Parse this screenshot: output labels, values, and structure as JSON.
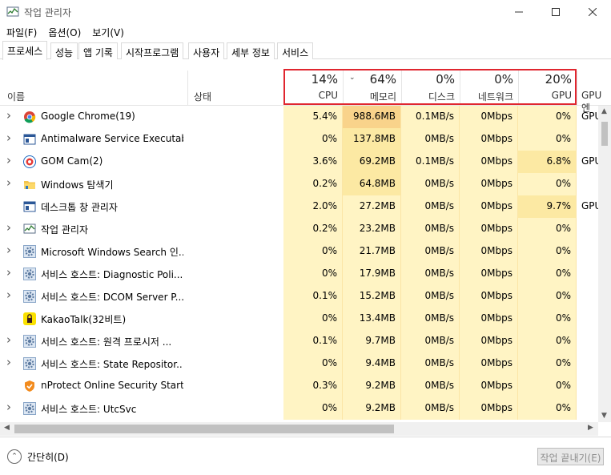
{
  "window": {
    "title": "작업 관리자"
  },
  "menu": [
    "파일(F)",
    "옵션(O)",
    "보기(V)"
  ],
  "tabs": [
    "프로세스",
    "성능",
    "앱 기록",
    "시작프로그램",
    "사용자",
    "세부 정보",
    "서비스"
  ],
  "header": {
    "name": "이름",
    "status": "상태",
    "cpu_pct": "14%",
    "cpu": "CPU",
    "mem_pct": "64%",
    "mem": "메모리",
    "disk_pct": "0%",
    "disk": "디스크",
    "net_pct": "0%",
    "net": "네트워크",
    "gpu_pct": "20%",
    "gpu": "GPU",
    "gpu_engine": "GPU 엔"
  },
  "rows": [
    {
      "name": "Google Chrome(19)",
      "cpu": "5.4%",
      "mem": "988.6MB",
      "disk": "0.1MB/s",
      "net": "0Mbps",
      "gpu": "0%",
      "gpueng": "GPU",
      "icon": "chrome-icon",
      "expand": true
    },
    {
      "name": "Antimalware Service Executable",
      "cpu": "0%",
      "mem": "137.8MB",
      "disk": "0MB/s",
      "net": "0Mbps",
      "gpu": "0%",
      "gpueng": "",
      "icon": "window-app-icon",
      "expand": true
    },
    {
      "name": "GOM Cam(2)",
      "cpu": "3.6%",
      "mem": "69.2MB",
      "disk": "0.1MB/s",
      "net": "0Mbps",
      "gpu": "6.8%",
      "gpueng": "GPU",
      "icon": "gomcam-icon",
      "expand": true
    },
    {
      "name": "Windows 탐색기",
      "cpu": "0.2%",
      "mem": "64.8MB",
      "disk": "0MB/s",
      "net": "0Mbps",
      "gpu": "0%",
      "gpueng": "",
      "icon": "folder-icon",
      "expand": true
    },
    {
      "name": "데스크톱 창 관리자",
      "cpu": "2.0%",
      "mem": "27.2MB",
      "disk": "0MB/s",
      "net": "0Mbps",
      "gpu": "9.7%",
      "gpueng": "GPU",
      "icon": "window-app-icon",
      "expand": false
    },
    {
      "name": "작업 관리자",
      "cpu": "0.2%",
      "mem": "23.2MB",
      "disk": "0MB/s",
      "net": "0Mbps",
      "gpu": "0%",
      "gpueng": "",
      "icon": "task-manager-icon",
      "expand": true
    },
    {
      "name": "Microsoft Windows Search 인...",
      "cpu": "0%",
      "mem": "21.7MB",
      "disk": "0MB/s",
      "net": "0Mbps",
      "gpu": "0%",
      "gpueng": "",
      "icon": "gear-icon",
      "expand": true
    },
    {
      "name": "서비스 호스트: Diagnostic Poli...",
      "cpu": "0%",
      "mem": "17.9MB",
      "disk": "0MB/s",
      "net": "0Mbps",
      "gpu": "0%",
      "gpueng": "",
      "icon": "gear-icon",
      "expand": true
    },
    {
      "name": "서비스 호스트: DCOM Server P...",
      "cpu": "0.1%",
      "mem": "15.2MB",
      "disk": "0MB/s",
      "net": "0Mbps",
      "gpu": "0%",
      "gpueng": "",
      "icon": "gear-icon",
      "expand": true
    },
    {
      "name": "KakaoTalk(32비트)",
      "cpu": "0%",
      "mem": "13.4MB",
      "disk": "0MB/s",
      "net": "0Mbps",
      "gpu": "0%",
      "gpueng": "",
      "icon": "kakaotalk-icon",
      "expand": false
    },
    {
      "name": "서비스 호스트: 원격 프로시저 ...",
      "cpu": "0.1%",
      "mem": "9.7MB",
      "disk": "0MB/s",
      "net": "0Mbps",
      "gpu": "0%",
      "gpueng": "",
      "icon": "gear-icon",
      "expand": true
    },
    {
      "name": "서비스 호스트: State Repositor...",
      "cpu": "0%",
      "mem": "9.4MB",
      "disk": "0MB/s",
      "net": "0Mbps",
      "gpu": "0%",
      "gpueng": "",
      "icon": "gear-icon",
      "expand": true
    },
    {
      "name": "nProtect Online Security Starte...",
      "cpu": "0.3%",
      "mem": "9.2MB",
      "disk": "0MB/s",
      "net": "0Mbps",
      "gpu": "0%",
      "gpueng": "",
      "icon": "shield-icon",
      "expand": false
    },
    {
      "name": "서비스 호스트: UtcSvc",
      "cpu": "0%",
      "mem": "9.2MB",
      "disk": "0MB/s",
      "net": "0Mbps",
      "gpu": "0%",
      "gpueng": "",
      "icon": "gear-icon",
      "expand": true
    }
  ],
  "footer": {
    "fewer": "간단히(D)",
    "end_task": "작업 끝내기(E)"
  },
  "colors": {
    "heat_low": "#fff4c4",
    "heat_mid": "#fce9a3",
    "heat_high": "#f9d38b",
    "highlight_box": "#e0262f"
  }
}
